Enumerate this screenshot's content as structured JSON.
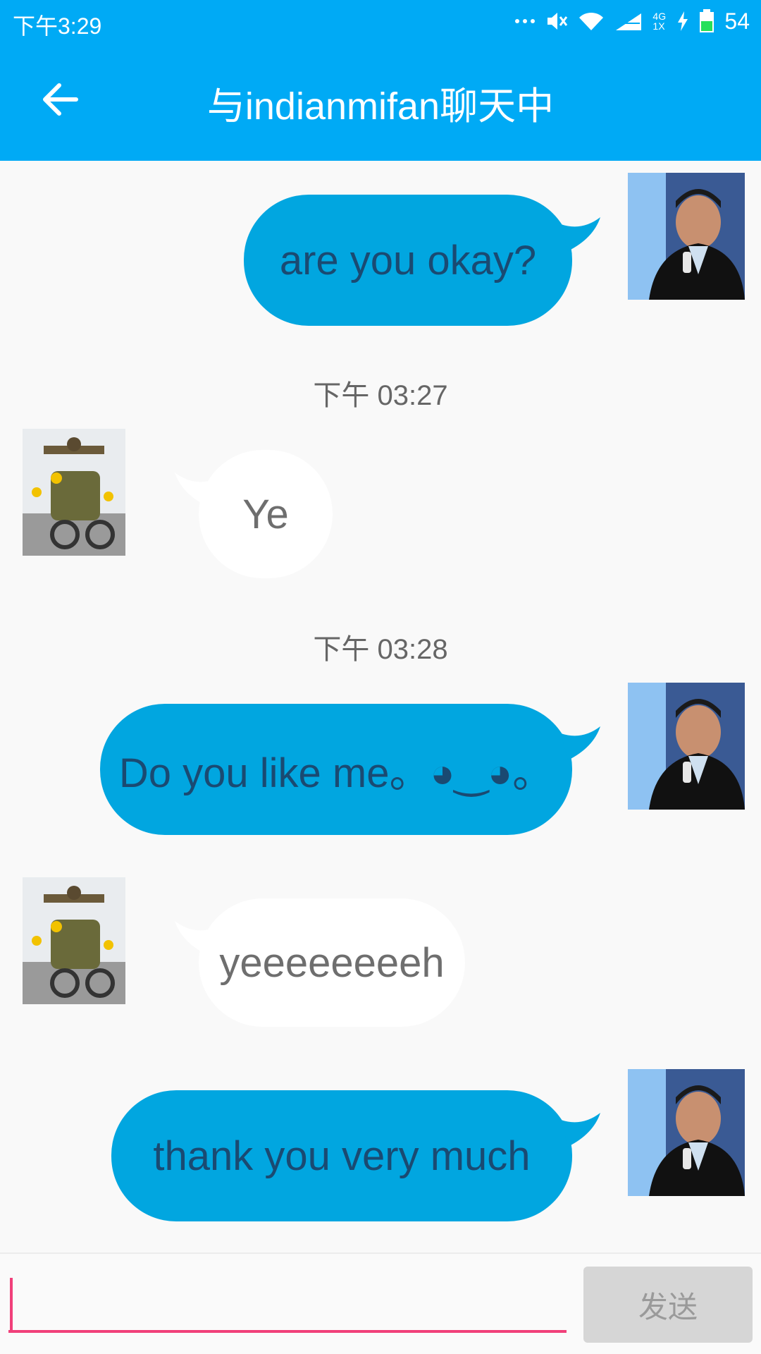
{
  "status_bar": {
    "time": "下午3:29",
    "network": "4G 1X",
    "battery": "54"
  },
  "app_bar": {
    "title": "与indianmifan聊天中"
  },
  "messages": [
    {
      "sender": "me",
      "text": "are you okay?"
    },
    {
      "type": "timestamp",
      "text": "下午 03:27"
    },
    {
      "sender": "them",
      "text": "Ye"
    },
    {
      "type": "timestamp",
      "text": "下午 03:28"
    },
    {
      "sender": "me",
      "text": "Do you like me。◕‿◕。"
    },
    {
      "sender": "them",
      "text": "yeeeeeeeeh"
    },
    {
      "sender": "me",
      "text": "thank you very much"
    }
  ],
  "input": {
    "value": "",
    "send_label": "发送"
  },
  "colors": {
    "accent": "#00aaf5",
    "my_bubble": "#01a6e0",
    "their_bubble": "#ffffff",
    "input_underline": "#f0407a"
  }
}
